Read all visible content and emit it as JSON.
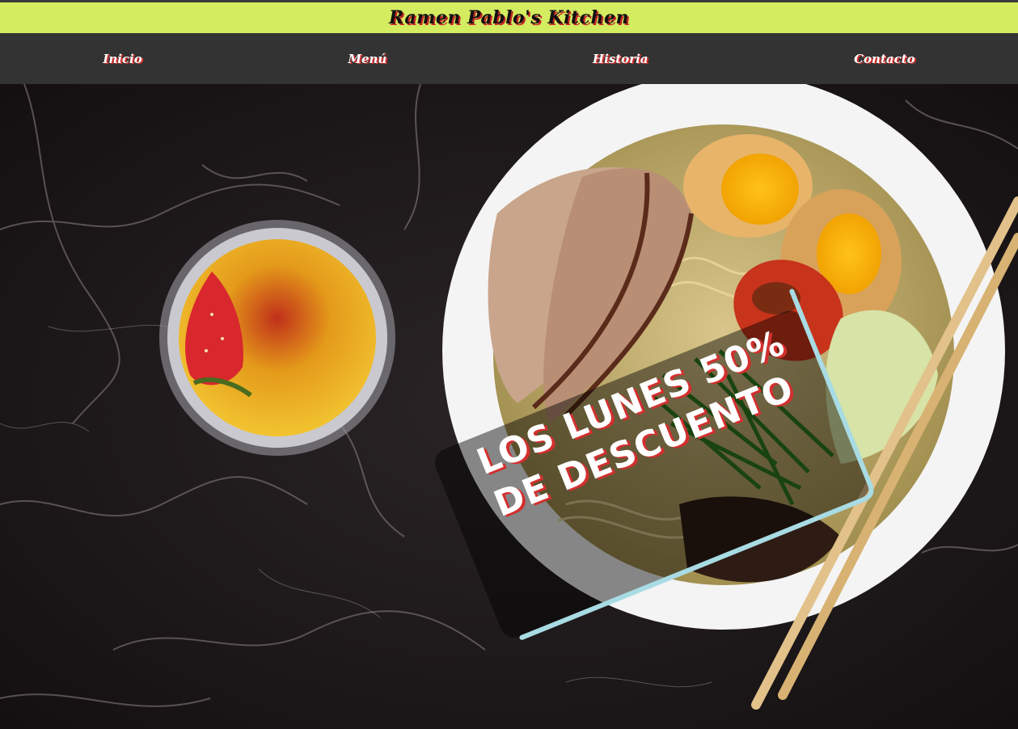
{
  "header": {
    "title": "Ramen Pablo's Kitchen",
    "background_color": "#d4ec60"
  },
  "nav": {
    "items": [
      {
        "label": "Inicio"
      },
      {
        "label": "Menú"
      },
      {
        "label": "Historia"
      },
      {
        "label": "Contacto"
      }
    ],
    "background_color": "#333333"
  },
  "hero": {
    "promo_line_1": "los lunes 50%",
    "promo_line_2": "de descuento",
    "accent_color": "#a8dbe3",
    "text_shadow_color": "#d32f2f"
  }
}
